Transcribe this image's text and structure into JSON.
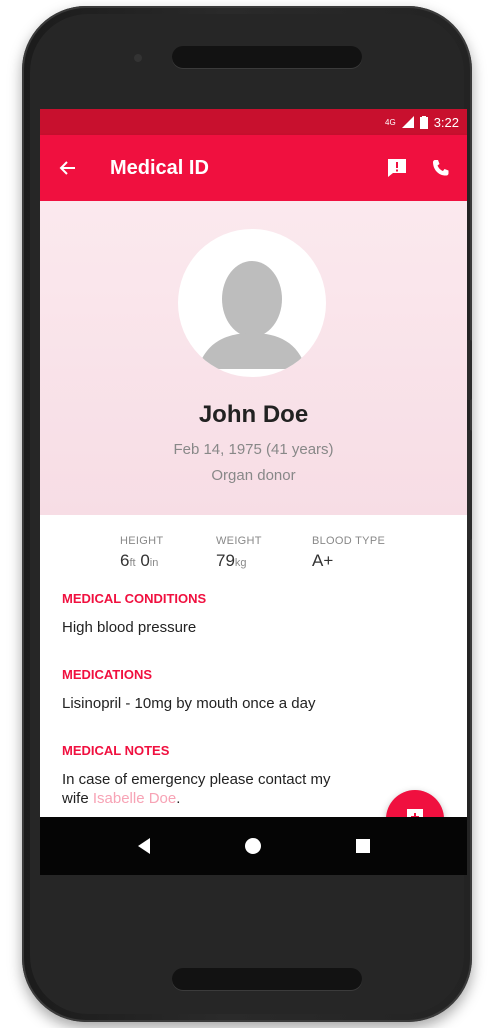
{
  "status_bar": {
    "network": "4G",
    "time": "3:22"
  },
  "app_bar": {
    "title": "Medical ID",
    "back_icon": "arrow-back-icon",
    "alert_icon": "alert-icon",
    "call_icon": "phone-icon"
  },
  "profile": {
    "name": "John Doe",
    "birthdate": "Feb 14, 1975 (41 years)",
    "donor_status": "Organ donor"
  },
  "stats": {
    "height": {
      "label": "HEIGHT",
      "feet": "6",
      "feet_unit": "ft",
      "inches": "0",
      "inches_unit": "in"
    },
    "weight": {
      "label": "WEIGHT",
      "value": "79",
      "unit": "kg"
    },
    "blood_type": {
      "label": "BLOOD TYPE",
      "value": "A+"
    }
  },
  "sections": {
    "conditions": {
      "title": "MEDICAL CONDITIONS",
      "body": "High blood pressure"
    },
    "medications": {
      "title": "MEDICATIONS",
      "body": "Lisinopril - 10mg by mouth once a day"
    },
    "notes": {
      "title": "MEDICAL NOTES",
      "body_prefix": "In case of emergency please contact my wife ",
      "contact_link": "Isabelle Doe",
      "body_suffix": "."
    }
  },
  "fab": {
    "icon": "add-medical-icon"
  },
  "nav": {
    "back": "back-icon",
    "home": "home-icon",
    "recents": "recents-icon"
  },
  "colors": {
    "accent": "#f0103f",
    "status_bar": "#c8102e",
    "header_bg": "#fbe9ee"
  }
}
